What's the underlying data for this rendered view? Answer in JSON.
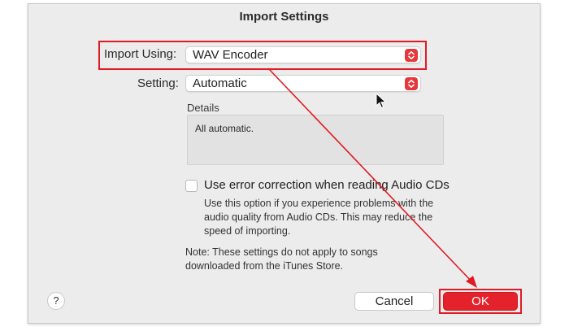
{
  "dialog": {
    "title": "Import Settings",
    "import_using_label": "Import Using:",
    "import_using_value": "WAV Encoder",
    "setting_label": "Setting:",
    "setting_value": "Automatic",
    "details_label": "Details",
    "details_text": "All automatic.",
    "error_correction": {
      "label": "Use error correction when reading Audio CDs",
      "checked": false,
      "description": [
        "Use this option if you experience problems with the",
        "audio quality from Audio CDs. This may reduce the",
        "speed of importing."
      ]
    },
    "note": [
      "Note: These settings do not apply to songs",
      "downloaded from the iTunes Store."
    ],
    "help_label": "?",
    "cancel_label": "Cancel",
    "ok_label": "OK"
  },
  "annotation_color": "#e01b24",
  "accent_color": "#e4222b"
}
